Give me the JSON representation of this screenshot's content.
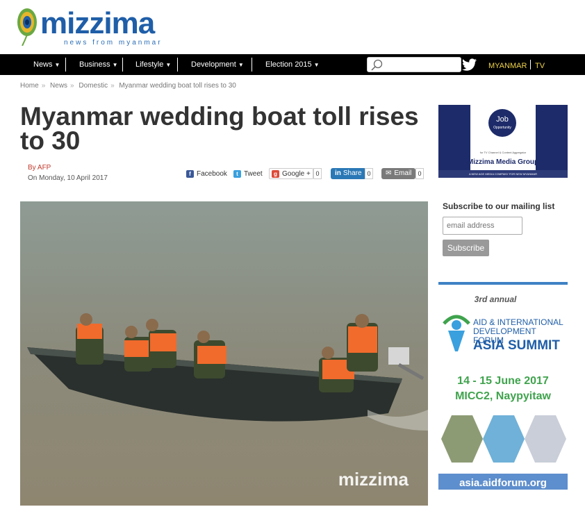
{
  "header": {
    "logo_text": "mizzima",
    "tagline": "news from myanmar"
  },
  "nav": {
    "items": [
      {
        "label": "News"
      },
      {
        "label": "Business"
      },
      {
        "label": "Lifestyle"
      },
      {
        "label": "Development"
      },
      {
        "label": "Election 2015"
      }
    ],
    "search_placeholder": "",
    "lang": [
      "MYANMAR",
      "TV"
    ]
  },
  "breadcrumb": [
    "Home",
    "News",
    "Domestic",
    "Myanmar wedding boat toll rises to 30"
  ],
  "breadcrumb_sep": "»",
  "article": {
    "title": "Myanmar wedding boat toll rises to 30",
    "byline": "By AFP",
    "date": "On Monday, 10 April 2017",
    "watermark": "mizzima"
  },
  "share": {
    "facebook": "Facebook",
    "tweet": "Tweet",
    "google": "Google +",
    "google_count": "0",
    "linkedin": "Share",
    "linkedin_count": "0",
    "email": "Email",
    "email_count": "0"
  },
  "sidebar": {
    "ad1": {
      "job": "Job",
      "opportunity": "Opportunity",
      "sub": "for TV Channel & Content Aggregator",
      "group": "Mizzima Media Group",
      "bar": "A NEW AGE MEDIA COMPANY FOR NEW MYANMAR"
    },
    "mailing_heading": "Subscribe to our mailing list",
    "email_placeholder": "email address",
    "subscribe_label": "Subscribe",
    "ad2": {
      "annual": "3rd annual",
      "aid": "AID & INTERNATIONAL DEVELOPMENT FORUM",
      "asia": "ASIA SUMMIT",
      "dates": "14 - 15 June 2017",
      "venue": "MICC2, Naypyitaw",
      "url": "asia.aidforum.org"
    }
  },
  "colors": {
    "brand_blue": "#1f5ea8",
    "nav_bg": "#000000",
    "lang_yellow": "#f1d44b",
    "forum_green": "#3fa34d"
  }
}
